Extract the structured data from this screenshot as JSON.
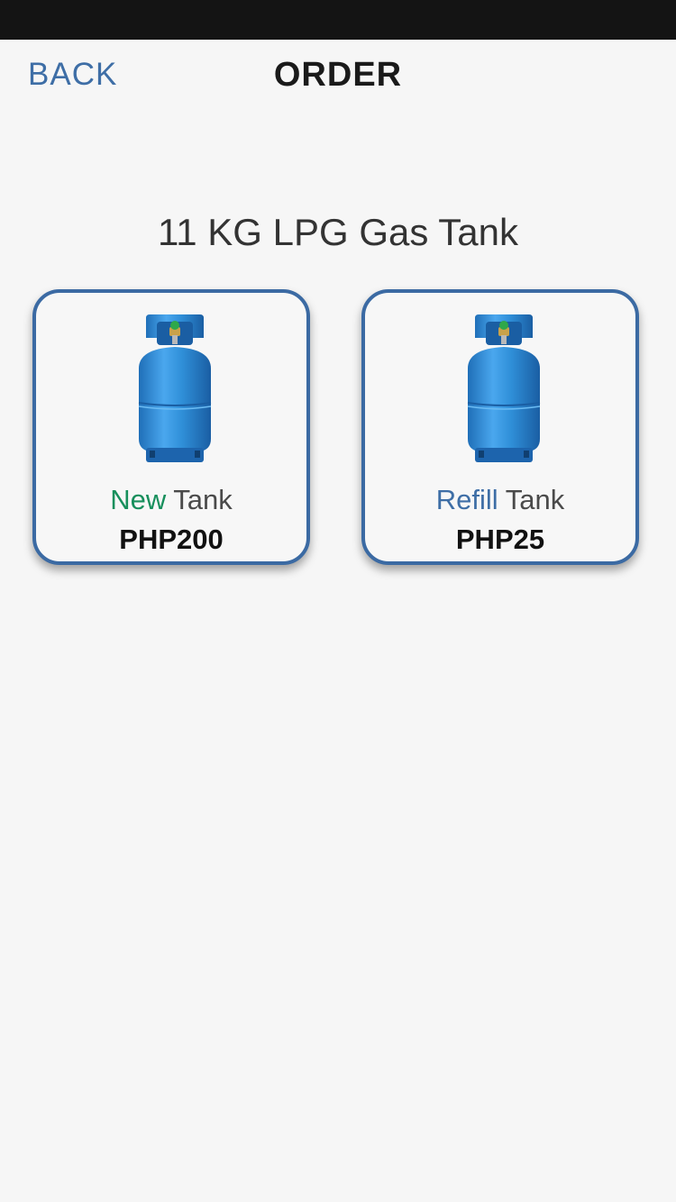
{
  "header": {
    "back_label": "BACK",
    "title": "ORDER"
  },
  "product": {
    "title": "11 KG LPG Gas Tank"
  },
  "options": [
    {
      "accent_word": "New",
      "rest_word": "Tank",
      "price": "PHP200",
      "accent_color": "#178f5c"
    },
    {
      "accent_word": "Refill",
      "rest_word": "Tank",
      "price": "PHP25",
      "accent_color": "#3e6ea6"
    }
  ],
  "colors": {
    "brand_blue": "#3e6ea6",
    "card_border": "#3b6aa3",
    "tank_blue": "#2f8fd8",
    "background": "#f6f6f6"
  }
}
